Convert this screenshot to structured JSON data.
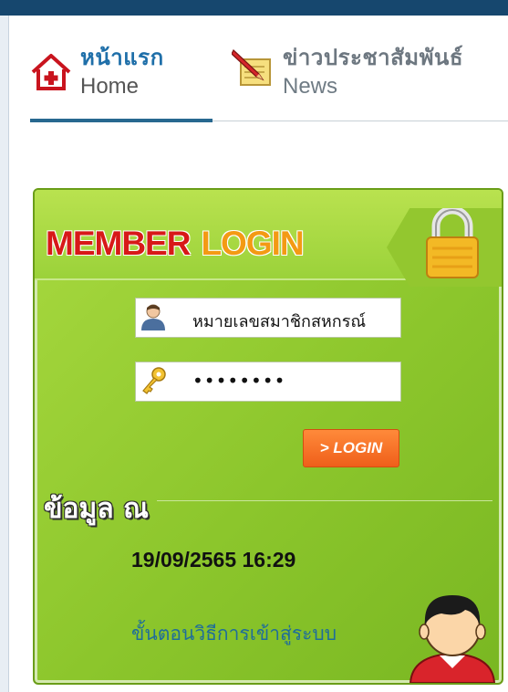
{
  "nav": {
    "items": [
      {
        "label_th": "หน้าแรก",
        "label_en": "Home",
        "icon": "home-icon"
      },
      {
        "label_th": "ข่าวประชาสัมพันธ์",
        "label_en": "News",
        "icon": "pencil-note-icon"
      }
    ],
    "active_index": 0
  },
  "login_panel": {
    "title_part1": "MEMBER",
    "title_part2": "LOGIN",
    "username_value": "หมายเลขสมาชิกสหกรณ์",
    "password_value": "••••••••",
    "login_button": "> LOGIN",
    "info_title": "ข้อมูล ณ",
    "datetime": "19/09/2565 16:29",
    "howto_link": "ขั้นตอนวิธีการเข้าสู่ระบบ"
  },
  "colors": {
    "header_bar": "#16476e",
    "nav_active": "#1f6fa9",
    "panel_green": "#8cc62c",
    "member_red": "#d71918",
    "login_orange": "#f39a14",
    "button_orange": "#ef5f1a"
  },
  "icons": [
    "home-icon",
    "pencil-note-icon",
    "padlock-icon",
    "user-icon",
    "key-icon",
    "person-avatar-icon"
  ]
}
